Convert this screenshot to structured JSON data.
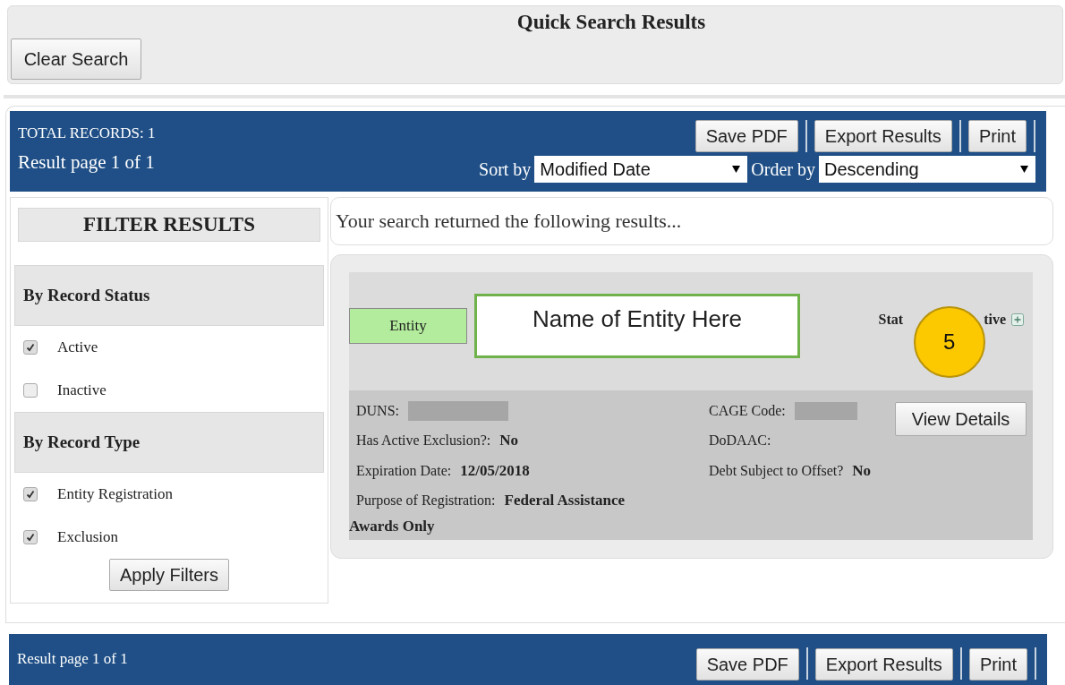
{
  "header": {
    "title": "Quick Search Results",
    "clear_button": "Clear Search"
  },
  "toolbar": {
    "total_records": "TOTAL RECORDS: 1",
    "page_info": "Result page 1 of 1",
    "buttons": [
      "Save PDF",
      "Export Results",
      "Print"
    ],
    "sort_label": "Sort by",
    "sort_value": "Modified Date",
    "order_label": "Order by",
    "order_value": "Descending"
  },
  "filters": {
    "title": "FILTER RESULTS",
    "groups": [
      {
        "heading": "By Record Status",
        "options": [
          {
            "label": "Active",
            "checked": true
          },
          {
            "label": "Inactive",
            "checked": false
          }
        ]
      },
      {
        "heading": "By Record Type",
        "options": [
          {
            "label": "Entity Registration",
            "checked": true
          },
          {
            "label": "Exclusion",
            "checked": true
          }
        ]
      }
    ],
    "apply_button": "Apply Filters"
  },
  "results": {
    "message": "Your search returned the following results...",
    "records": [
      {
        "type_tag": "Entity",
        "name": "Name of Entity Here",
        "status_label": "Stat",
        "status_value": "tive",
        "callout": "5",
        "fields_left": [
          {
            "label": "DUNS:",
            "redacted": true
          },
          {
            "label": "Has Active Exclusion?:",
            "value": "No"
          },
          {
            "label": "Expiration Date:",
            "value": "12/05/2018"
          },
          {
            "label": "Purpose of Registration:",
            "value": "Federal Assistance"
          }
        ],
        "continuation": "Awards Only",
        "fields_right": [
          {
            "label": "CAGE Code:",
            "redacted": true
          },
          {
            "label": "DoDAAC:"
          },
          {
            "label": "Debt Subject to Offset?",
            "value": "No"
          }
        ],
        "action": "View Details"
      }
    ]
  },
  "footer": {
    "page_info": "Result page 1 of 1",
    "buttons": [
      "Save PDF",
      "Export Results",
      "Print"
    ]
  }
}
